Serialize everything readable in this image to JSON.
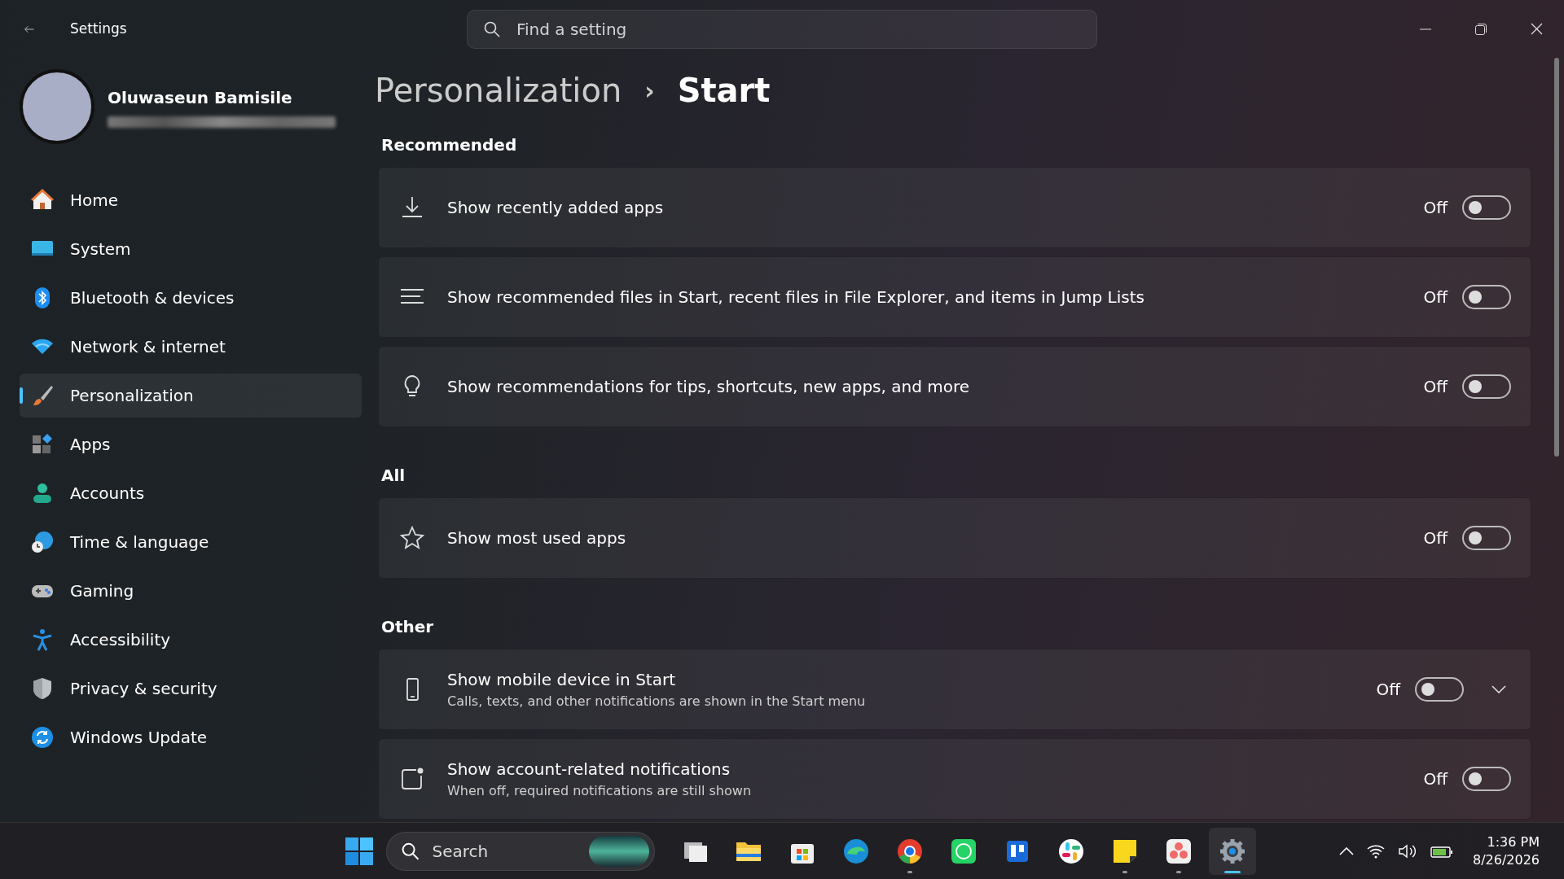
{
  "window": {
    "title": "Settings"
  },
  "search": {
    "placeholder": "Find a setting"
  },
  "user": {
    "name": "Oluwaseun Bamisile"
  },
  "sidebar": {
    "items": [
      {
        "label": "Home",
        "selected": false
      },
      {
        "label": "System",
        "selected": false
      },
      {
        "label": "Bluetooth & devices",
        "selected": false
      },
      {
        "label": "Network & internet",
        "selected": false
      },
      {
        "label": "Personalization",
        "selected": true
      },
      {
        "label": "Apps",
        "selected": false
      },
      {
        "label": "Accounts",
        "selected": false
      },
      {
        "label": "Time & language",
        "selected": false
      },
      {
        "label": "Gaming",
        "selected": false
      },
      {
        "label": "Accessibility",
        "selected": false
      },
      {
        "label": "Privacy & security",
        "selected": false
      },
      {
        "label": "Windows Update",
        "selected": false
      }
    ]
  },
  "breadcrumb": {
    "parent": "Personalization",
    "separator": "›",
    "current": "Start"
  },
  "sections": [
    {
      "title": "Recommended",
      "rows": [
        {
          "title": "Show recently added apps",
          "state": "Off",
          "on": false
        },
        {
          "title": "Show recommended files in Start, recent files in File Explorer, and items in Jump Lists",
          "state": "Off",
          "on": false
        },
        {
          "title": "Show recommendations for tips, shortcuts, new apps, and more",
          "state": "Off",
          "on": false
        }
      ]
    },
    {
      "title": "All",
      "rows": [
        {
          "title": "Show most used apps",
          "state": "Off",
          "on": false
        }
      ]
    },
    {
      "title": "Other",
      "rows": [
        {
          "title": "Show mobile device in Start",
          "description": "Calls, texts, and other notifications are shown in the Start menu",
          "state": "Off",
          "on": false,
          "expanded": false
        },
        {
          "title": "Show account-related notifications",
          "description": "When off, required notifications are still shown",
          "state": "Off",
          "on": false
        }
      ]
    }
  ],
  "taskbar": {
    "search_placeholder": "Search",
    "apps": [
      {
        "running": false,
        "selected": false
      },
      {
        "running": false,
        "selected": false
      },
      {
        "running": false,
        "selected": false
      },
      {
        "running": false,
        "selected": false
      },
      {
        "running": true,
        "selected": false
      },
      {
        "running": false,
        "selected": false
      },
      {
        "running": false,
        "selected": false
      },
      {
        "running": false,
        "selected": false
      },
      {
        "running": true,
        "selected": false
      },
      {
        "running": true,
        "selected": false
      },
      {
        "running": true,
        "selected": true
      }
    ],
    "time": "1:36 PM",
    "date": "8/26/2026"
  }
}
